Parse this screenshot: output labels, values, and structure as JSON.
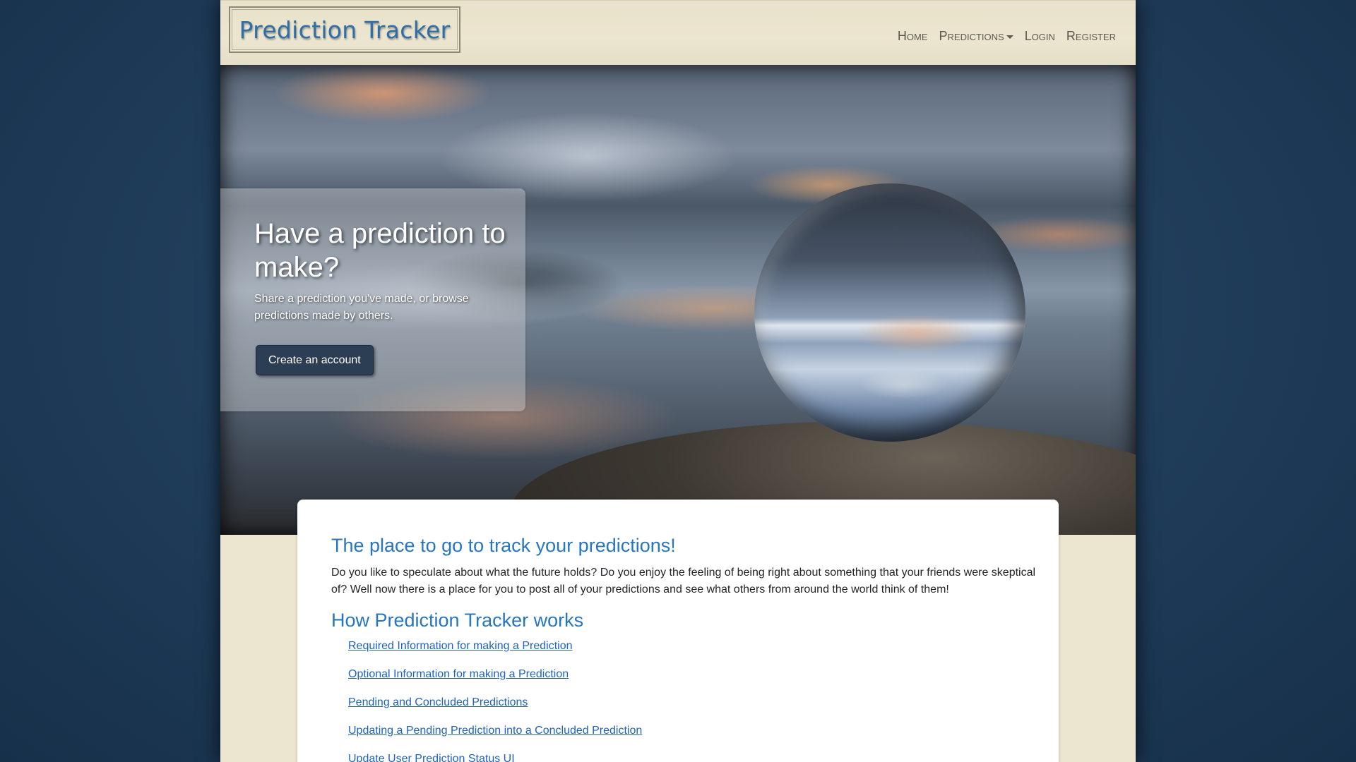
{
  "navbar": {
    "brand": "Prediction Tracker",
    "items": [
      {
        "label": "Home"
      },
      {
        "label": "Predictions",
        "has_dropdown": true
      },
      {
        "label": "Login"
      },
      {
        "label": "Register"
      }
    ]
  },
  "hero": {
    "title": "Have a prediction to make?",
    "subtitle": "Share a prediction you've made, or browse predictions made by others.",
    "button_label": "Create an account",
    "image": "crystal-ball-on-rock-at-sunset"
  },
  "main": {
    "heading": "The place to go to track your predictions!",
    "intro": "Do you like to speculate about what the future holds? Do you enjoy the feeling of being right about something that your friends were skeptical of? Well now there is a place for you to post all of your predictions and see what others from around the world think of them!",
    "how_heading": "How Prediction Tracker works",
    "links": [
      "Required Information for making a Prediction",
      "Optional Information for making a Prediction",
      "Pending and Concluded Predictions",
      "Updating a Pending Prediction into a Concluded Prediction",
      "Update User Prediction Status UI"
    ]
  },
  "colors": {
    "page_bg": "#ece5cf",
    "accent": "#2776c0",
    "link": "#1f63c0",
    "button": "#2c3e54",
    "outer_bg": "#22405e"
  }
}
